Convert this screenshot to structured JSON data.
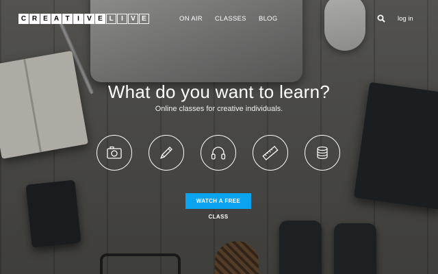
{
  "header": {
    "logo_letters": [
      "C",
      "R",
      "E",
      "A",
      "T",
      "I",
      "V",
      "E",
      "L",
      "I",
      "V",
      "E"
    ],
    "nav_items": [
      "ON AIR",
      "CLASSES",
      "BLOG"
    ],
    "login_label": "log in",
    "search_icon": "search-icon"
  },
  "hero": {
    "title": "What do you want to learn?",
    "subtitle": "Online classes for creative individuals.",
    "categories": [
      {
        "icon": "camera-icon"
      },
      {
        "icon": "pencil-icon"
      },
      {
        "icon": "headphones-icon"
      },
      {
        "icon": "ruler-icon"
      },
      {
        "icon": "coins-icon"
      }
    ],
    "cta_label": "WATCH A FREE CLASS"
  },
  "colors": {
    "cta_background": "#0aa3f0",
    "text": "#ffffff"
  }
}
